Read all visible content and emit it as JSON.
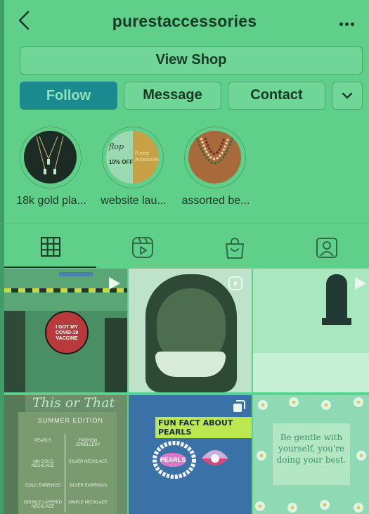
{
  "header": {
    "username": "purestaccessories"
  },
  "buttons": {
    "view_shop": "View Shop",
    "follow": "Follow",
    "message": "Message",
    "contact": "Contact"
  },
  "highlights": [
    {
      "label": "18k gold pla..."
    },
    {
      "label": "website lau...",
      "cover_text_1": "Purest",
      "cover_text_2": "Accessories",
      "cover_text_3": "10% OFF"
    },
    {
      "label": "assorted be..."
    }
  ],
  "tabs": [
    {
      "icon": "grid-icon",
      "active": true
    },
    {
      "icon": "reels-icon",
      "active": false
    },
    {
      "icon": "shop-bag-icon",
      "active": false
    },
    {
      "icon": "tagged-icon",
      "active": false
    }
  ],
  "posts": {
    "covid_sign": "I GOT MY COVID-19 VACCINE",
    "fun_fact": "FUN FACT ABOUT PEARLS",
    "pearls_tag": "PEARLS",
    "gentle_text": "Be gentle with yourself, you're doing your best.",
    "this_or_that": "This or That",
    "summer_edition": "SUMMER EDITION",
    "col_left": [
      "PEARLS",
      "14K GOLD NECKLACE",
      "GOLD EARRINGS",
      "DOUBLE LAYERED NECKLACE"
    ],
    "col_right": [
      "FASHION JEWELLERY",
      "SILVER NECKLACE",
      "SILVER EARRINGS",
      "SIMPLE NECKLACE"
    ]
  },
  "colors": {
    "accent_follow": "#1b8a8f",
    "overlay": "#5fcf8a"
  }
}
